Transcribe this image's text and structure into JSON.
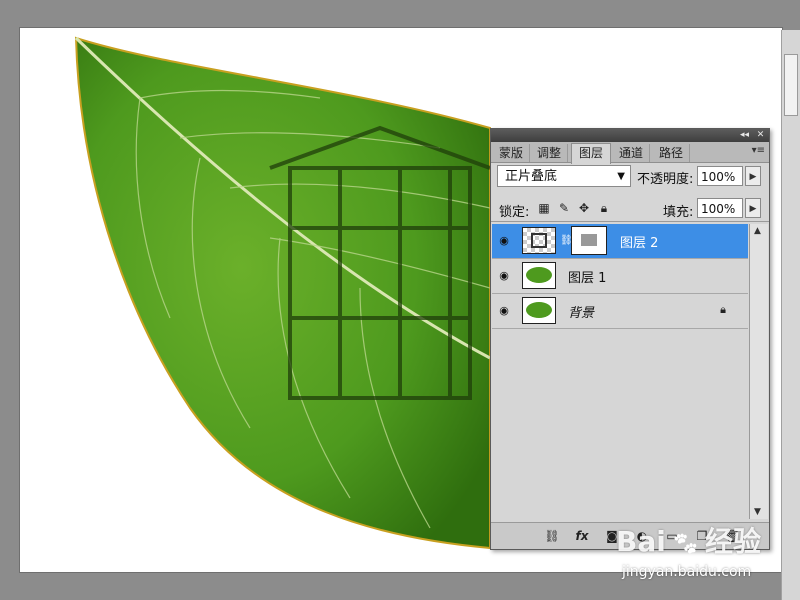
{
  "panel": {
    "tabs": [
      {
        "label": "蒙版"
      },
      {
        "label": "调整"
      },
      {
        "label": "图层",
        "active": true
      },
      {
        "label": "通道"
      },
      {
        "label": "路径"
      }
    ],
    "blend_mode": "正片叠底",
    "opacity_label": "不透明度:",
    "opacity_value": "100%",
    "lock_label": "锁定:",
    "fill_label": "填充:",
    "fill_value": "100%",
    "layers": [
      {
        "name": "图层 2",
        "selected": true,
        "has_mask": true
      },
      {
        "name": "图层 1",
        "selected": false
      },
      {
        "name": "背景",
        "selected": false,
        "locked": true
      }
    ]
  },
  "watermark": {
    "brand": "Bai",
    "brand_cn": "经验",
    "url": "jingyan.baidu.com"
  },
  "colors": {
    "leaf_green": "#4e9a1e",
    "selection_blue": "#3d8ee6",
    "panel_gray": "#d6d6d6"
  }
}
